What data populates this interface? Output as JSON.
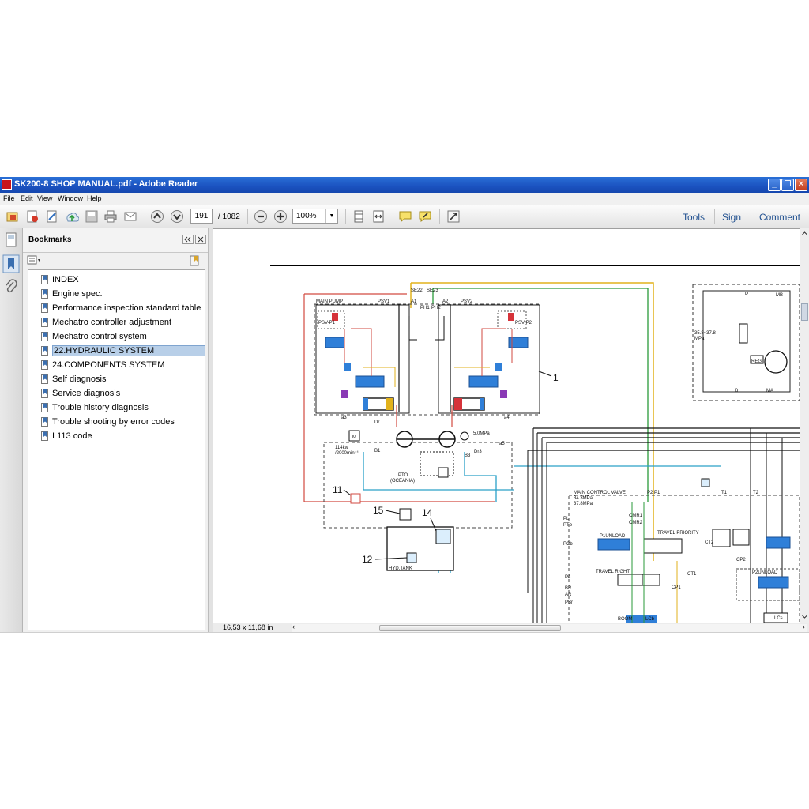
{
  "window": {
    "title": "SK200-8 SHOP MANUAL.pdf - Adobe Reader"
  },
  "menu": [
    "File",
    "Edit",
    "View",
    "Window",
    "Help"
  ],
  "toolbar": {
    "page_current": "191",
    "page_total": "/ 1082",
    "zoom": "100%",
    "tools_label": "Tools",
    "sign_label": "Sign",
    "comment_label": "Comment"
  },
  "bookmarks": {
    "header": "Bookmarks",
    "selected_index": 5,
    "items": [
      "INDEX",
      "Engine spec.",
      "Performance inspection standard table",
      "Mechatro controller adjustment",
      "Mechatro control system",
      "22.HYDRAULIC SYSTEM",
      "24.COMPONENTS SYSTEM",
      "Self diagnosis",
      "Service diagnosis",
      "Trouble history diagnosis",
      "Trouble shooting by error codes",
      "I 113 code"
    ]
  },
  "status": {
    "page_size": "16,53 x 11,68 in"
  },
  "schematic": {
    "labels": {
      "main_pump": "MAIN PUMP",
      "psv1": "PSV1",
      "psv2": "PSV2",
      "psv_p1": "PSV-P1",
      "psv_p2": "PSV-P2",
      "se22": "SE22",
      "se23": "SE23",
      "a1": "A1",
      "a2": "A2",
      "ph1": "PH1",
      "ph2": "PH2",
      "a3": "a3",
      "a4": "a4",
      "dr": "Dr",
      "b1": "B1",
      "b3": "B3",
      "dr3": "Dr3",
      "a5": "a5",
      "motor": "M",
      "power": "114kw",
      "rpm": "/2000min⁻¹",
      "pressure_5mpa": "5.0MPa",
      "pto": "PTO",
      "oceania": "(OCEANIA)",
      "hyd_tank": "HYD.TANK",
      "main_control_valve": "MAIN CONTROL VALVE",
      "mcv_p1": "34.3MPa",
      "mcv_p2": "37.8MPa",
      "p2": "P2",
      "p1": "P1",
      "t1": "T1",
      "t2": "T2",
      "pl": "PL",
      "ptb": "PTb",
      "pcb": "PCb",
      "pa": "PA",
      "br": "BR",
      "ar": "AR",
      "pbr": "PBr",
      "cmr1": "CMR1",
      "cmr2": "CMR2",
      "p1unload": "P1UNLOAD",
      "travel_priority": "TRAVEL PRIORITY",
      "travel_right": "TRAVEL RIGHT",
      "ct1": "CT1",
      "ct2": "CT2",
      "cp1": "CP1",
      "cp2": "CP2",
      "p2unload": "P2UNLOAD",
      "boom": "BOOM",
      "lcb": "LCb",
      "lcs": "LCs",
      "mb": "MB",
      "ma": "MA",
      "reg": "REG",
      "pp": "P",
      "dd": "D",
      "aux_pressure": "35.8~37.8",
      "aux_unit": "MPa",
      "callout_1": "1",
      "callout_11": "11",
      "callout_12": "12",
      "callout_14": "14",
      "callout_15": "15"
    }
  }
}
